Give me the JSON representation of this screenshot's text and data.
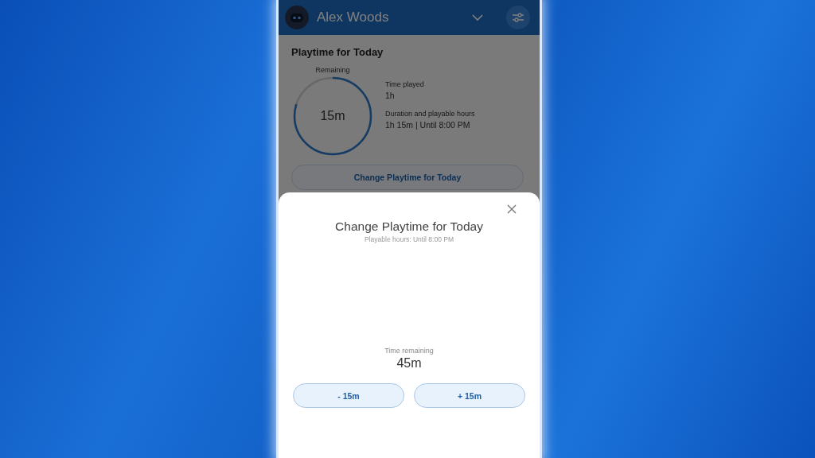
{
  "header": {
    "name": "Alex Woods"
  },
  "card": {
    "title": "Playtime for Today",
    "ring": {
      "label": "Remaining",
      "value": "15m"
    },
    "stats": [
      {
        "label": "Time played",
        "value": "1h"
      },
      {
        "label": "Duration and playable hours",
        "value": "1h 15m | Until 8:00 PM"
      }
    ],
    "button": "Change Playtime for Today"
  },
  "dialog": {
    "title": "Change Playtime for Today",
    "subtitle": "Playable hours: Until 8:00 PM",
    "remaining_label": "Time remaining",
    "remaining_value": "45m",
    "buttons": [
      "- 15m",
      "+ 15m"
    ]
  }
}
